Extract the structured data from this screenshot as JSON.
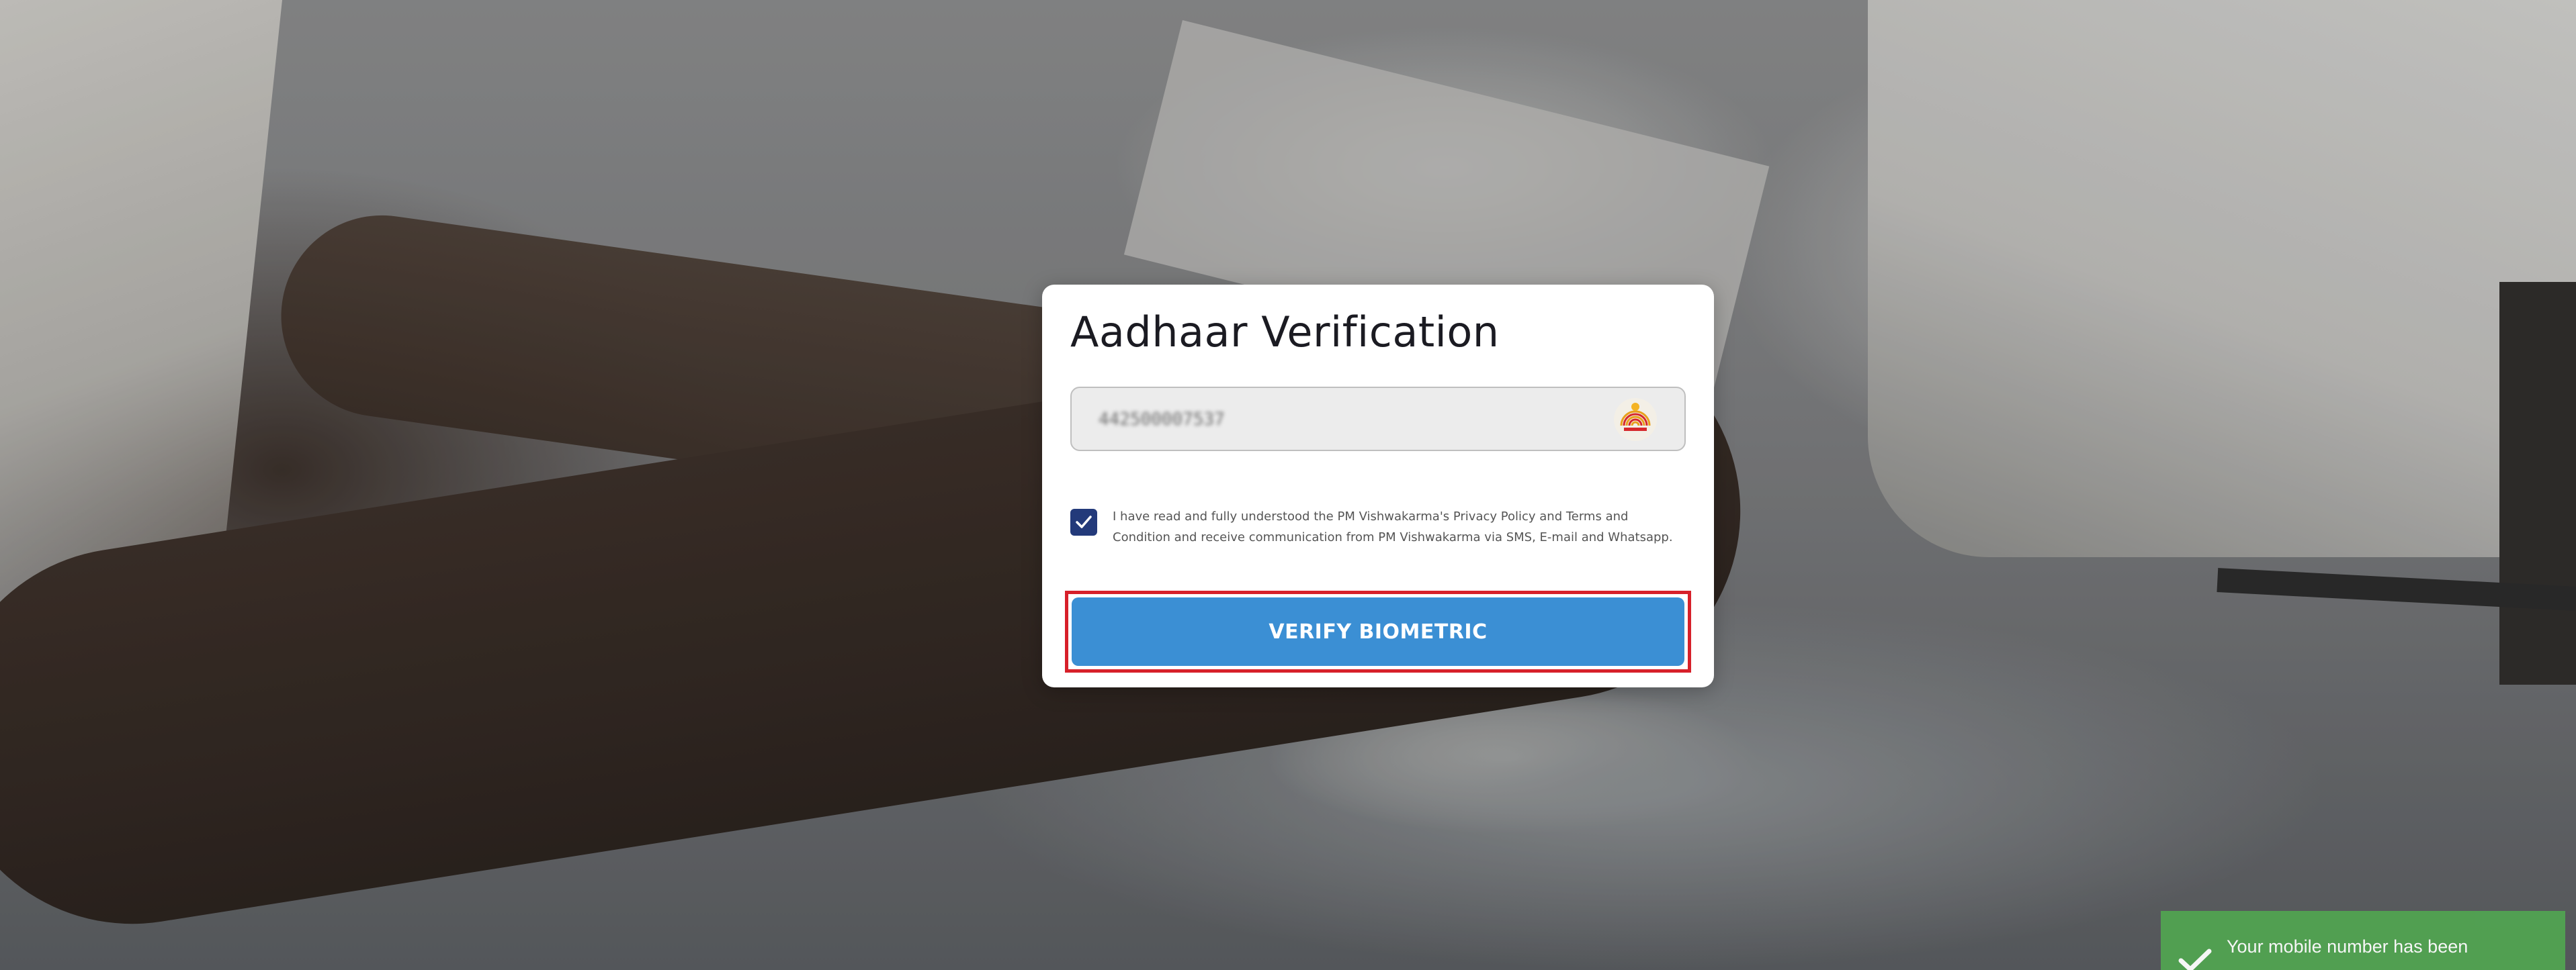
{
  "card": {
    "title": "Aadhaar Verification",
    "aadhaar_value": "442500007537",
    "consent_text": "I have read and fully understood the PM Vishwakarma's Privacy Policy and Terms and Condition and receive communication from PM Vishwakarma via SMS, E-mail and Whatsapp.",
    "consent_checked": true,
    "verify_label": "VERIFY BIOMETRIC"
  },
  "toast": {
    "message": "Your mobile number has been"
  },
  "colors": {
    "checkbox": "#233a7a",
    "button": "#3b8fd4",
    "highlight_border": "#d7202a",
    "toast": "#51a351"
  },
  "icons": {
    "checkbox": "checkmark-icon",
    "field": "aadhaar-logo-icon",
    "toast": "check-icon"
  }
}
